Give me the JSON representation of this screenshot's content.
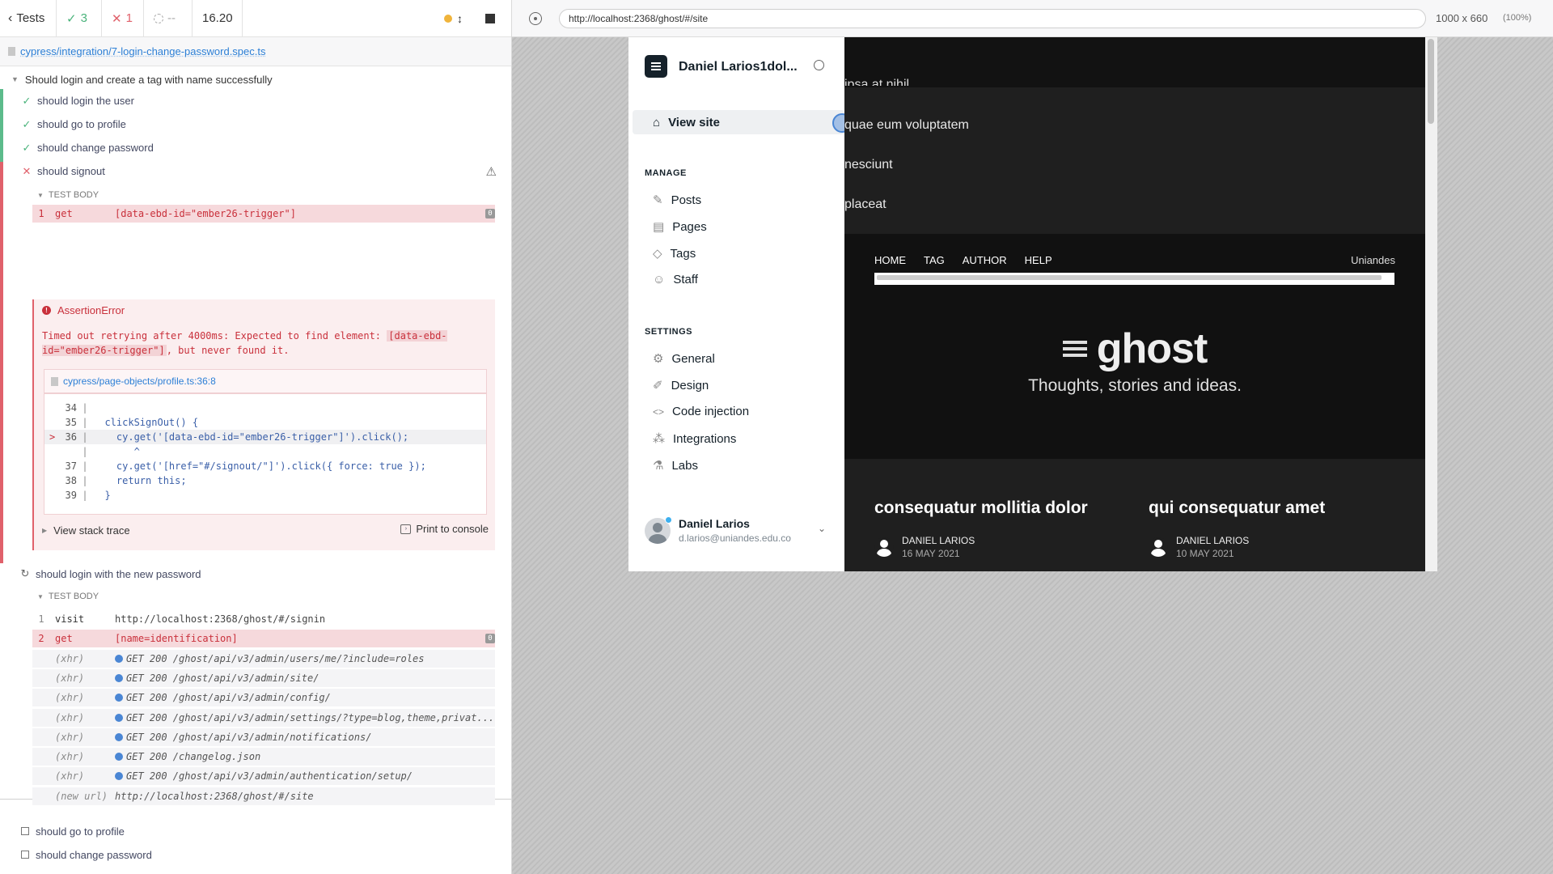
{
  "reporter": {
    "tests_label": "Tests",
    "passed": "3",
    "failed": "1",
    "pending": "--",
    "duration": "16.20",
    "spec_path": "cypress/integration/7-login-change-password.spec.ts",
    "suite_title": "Should login and create a tag with name successfully",
    "tests": [
      {
        "title": "should login the user",
        "state": "passed"
      },
      {
        "title": "should go to profile",
        "state": "passed"
      },
      {
        "title": "should change password",
        "state": "passed"
      },
      {
        "title": "should signout",
        "state": "failed"
      },
      {
        "title": "should login with the new password",
        "state": "running"
      },
      {
        "title": "should go to profile",
        "state": "pending"
      },
      {
        "title": "should change password",
        "state": "pending"
      }
    ],
    "test_body_label": "TEST BODY",
    "signout_cmd": {
      "num": "1",
      "name": "get",
      "msg": "[data-ebd-id=\"ember26-trigger\"]",
      "count": "0"
    },
    "error": {
      "title": "AssertionError",
      "msg1": "Timed out retrying after 4000ms: Expected to find element: ",
      "msg_code": "[data-ebd-id=\"ember26-trigger\"]",
      "msg2": ", but never found it.",
      "file": "cypress/page-objects/profile.ts:36:8",
      "code_lines": [
        {
          "n": "34",
          "code": ""
        },
        {
          "n": "35",
          "code": "  clickSignOut() {"
        },
        {
          "n": "36",
          "code": "    cy.get('[data-ebd-id=\"ember26-trigger\"]').click();",
          "current": true
        },
        {
          "n": "",
          "code": "       ^"
        },
        {
          "n": "37",
          "code": "    cy.get('[href=\"#/signout/\"]').click({ force: true });"
        },
        {
          "n": "38",
          "code": "    return this;"
        },
        {
          "n": "39",
          "code": "  }"
        }
      ],
      "stack_label": "View stack trace",
      "print_label": "Print to console"
    },
    "login_cmds": [
      {
        "num": "1",
        "name": "visit",
        "msg": "http://localhost:2368/ghost/#/signin",
        "type": "normal"
      },
      {
        "num": "2",
        "name": "get",
        "msg": "[name=identification]",
        "type": "err",
        "count": "0"
      },
      {
        "num": "",
        "name": "(xhr)",
        "msg": "GET 200 /ghost/api/v3/admin/users/me/?include=roles",
        "type": "xhr"
      },
      {
        "num": "",
        "name": "(xhr)",
        "msg": "GET 200 /ghost/api/v3/admin/site/",
        "type": "xhr"
      },
      {
        "num": "",
        "name": "(xhr)",
        "msg": "GET 200 /ghost/api/v3/admin/config/",
        "type": "xhr"
      },
      {
        "num": "",
        "name": "(xhr)",
        "msg": "GET 200 /ghost/api/v3/admin/settings/?type=blog,theme,privat...",
        "type": "xhr"
      },
      {
        "num": "",
        "name": "(xhr)",
        "msg": "GET 200 /ghost/api/v3/admin/notifications/",
        "type": "xhr"
      },
      {
        "num": "",
        "name": "(xhr)",
        "msg": "GET 200 /changelog.json",
        "type": "xhr"
      },
      {
        "num": "",
        "name": "(xhr)",
        "msg": "GET 200 /ghost/api/v3/admin/authentication/setup/",
        "type": "xhr"
      },
      {
        "num": "",
        "name": "(new url)",
        "msg": "http://localhost:2368/ghost/#/site",
        "type": "xhr"
      }
    ]
  },
  "aut": {
    "url": "http://localhost:2368/ghost/#/site",
    "viewport": "1000 x 660",
    "scale": "(100%)"
  },
  "ghost": {
    "site_title": "Daniel Larios1dol...",
    "view_site": "View site",
    "manage_label": "MANAGE",
    "manage": [
      "Posts",
      "Pages",
      "Tags",
      "Staff"
    ],
    "settings_label": "SETTINGS",
    "settings": [
      "General",
      "Design",
      "Code injection",
      "Integrations",
      "Labs"
    ],
    "user_name": "Daniel Larios",
    "user_email": "d.larios@uniandes.edu.co"
  },
  "site": {
    "partial_lines": [
      "ipsa at nihil",
      "quae eum voluptatem",
      "nesciunt",
      "placeat"
    ],
    "nav": [
      "HOME",
      "TAG",
      "AUTHOR",
      "HELP"
    ],
    "nav_right": "Uniandes",
    "logo": "ghost",
    "tagline": "Thoughts, stories and ideas.",
    "posts": [
      {
        "title": "consequatur mollitia dolor",
        "author": "DANIEL LARIOS",
        "date": "16 MAY 2021"
      },
      {
        "title": "qui consequatur amet",
        "author": "DANIEL LARIOS",
        "date": "10 MAY 2021"
      }
    ]
  },
  "colors": {
    "pass": "#5cbb8b",
    "fail": "#e0616b",
    "link": "#2c7fd6",
    "accent_blue": "#4a86d4"
  }
}
